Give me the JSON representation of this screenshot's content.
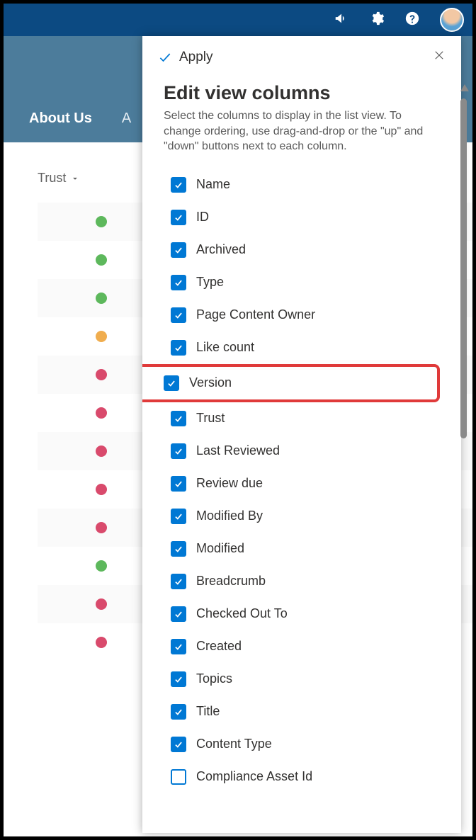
{
  "topbar": {
    "icons": [
      "megaphone",
      "gear",
      "help"
    ]
  },
  "secondnav": {
    "items": [
      {
        "label": "About Us",
        "bold": true
      }
    ]
  },
  "background": {
    "column_header": "Trust",
    "rows": [
      {
        "color": "green"
      },
      {
        "color": "green"
      },
      {
        "color": "green"
      },
      {
        "color": "yellow"
      },
      {
        "color": "pink"
      },
      {
        "color": "pink"
      },
      {
        "color": "pink"
      },
      {
        "color": "pink"
      },
      {
        "color": "pink"
      },
      {
        "color": "green"
      },
      {
        "color": "pink"
      },
      {
        "color": "pink"
      }
    ]
  },
  "panel": {
    "apply_label": "Apply",
    "title": "Edit view columns",
    "description": "Select the columns to display in the list view. To change ordering, use drag-and-drop or the \"up\" and \"down\" buttons next to each column.",
    "columns": [
      {
        "label": "Name",
        "checked": true,
        "highlight": false
      },
      {
        "label": "ID",
        "checked": true,
        "highlight": false
      },
      {
        "label": "Archived",
        "checked": true,
        "highlight": false
      },
      {
        "label": "Type",
        "checked": true,
        "highlight": false
      },
      {
        "label": "Page Content Owner",
        "checked": true,
        "highlight": false
      },
      {
        "label": "Like count",
        "checked": true,
        "highlight": false
      },
      {
        "label": "Version",
        "checked": true,
        "highlight": true
      },
      {
        "label": "Trust",
        "checked": true,
        "highlight": false
      },
      {
        "label": "Last Reviewed",
        "checked": true,
        "highlight": false
      },
      {
        "label": "Review due",
        "checked": true,
        "highlight": false
      },
      {
        "label": "Modified By",
        "checked": true,
        "highlight": false
      },
      {
        "label": "Modified",
        "checked": true,
        "highlight": false
      },
      {
        "label": "Breadcrumb",
        "checked": true,
        "highlight": false
      },
      {
        "label": "Checked Out To",
        "checked": true,
        "highlight": false
      },
      {
        "label": "Created",
        "checked": true,
        "highlight": false
      },
      {
        "label": "Topics",
        "checked": true,
        "highlight": false
      },
      {
        "label": "Title",
        "checked": true,
        "highlight": false
      },
      {
        "label": "Content Type",
        "checked": true,
        "highlight": false
      },
      {
        "label": "Compliance Asset Id",
        "checked": false,
        "highlight": false
      }
    ]
  }
}
